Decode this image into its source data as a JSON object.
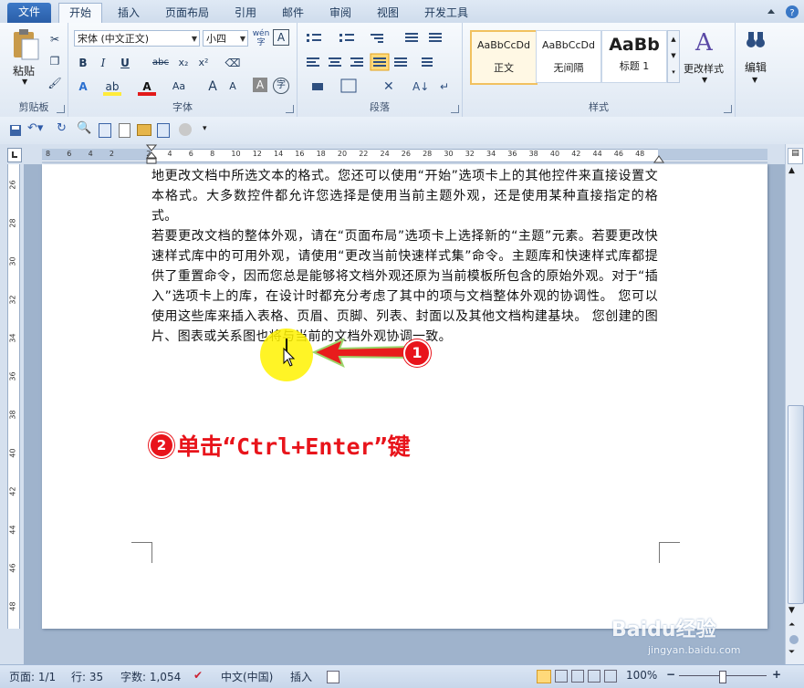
{
  "tabs": [
    "文件",
    "开始",
    "插入",
    "页面布局",
    "引用",
    "邮件",
    "审阅",
    "视图",
    "开发工具"
  ],
  "ribbon": {
    "clipboard": {
      "paste": "粘贴",
      "label": "剪贴板"
    },
    "font": {
      "name": "宋体 (中文正文)",
      "size": "小四",
      "label": "字体",
      "wen": "wén",
      "A": "A",
      "bold": "B",
      "italic": "I",
      "underline": "U",
      "strike": "abc",
      "sub": "x₂",
      "sup": "x²",
      "aa": "Aa",
      "grow": "A",
      "shrink": "A"
    },
    "paragraph": {
      "label": "段落"
    },
    "styles": {
      "label": "样式",
      "tiles": [
        {
          "preview": "AaBbCcDd",
          "name": "正文"
        },
        {
          "preview": "AaBbCcDd",
          "name": "无间隔"
        },
        {
          "preview": "AaBb",
          "name": "标题 1"
        }
      ],
      "change": "更改样式"
    },
    "edit": {
      "label": "编辑"
    }
  },
  "ruler_numbers": [
    "8",
    "6",
    "4",
    "2",
    "2",
    "4",
    "6",
    "8",
    "10",
    "12",
    "14",
    "16",
    "18",
    "20",
    "22",
    "24",
    "26",
    "28",
    "30",
    "32",
    "34",
    "36",
    "38",
    "40",
    "42",
    "44",
    "46",
    "48"
  ],
  "vruler_numbers": [
    "26",
    "28",
    "30",
    "32",
    "34",
    "36",
    "38",
    "40",
    "42",
    "44",
    "46",
    "48"
  ],
  "document": {
    "p1": "地更改文档中所选文本的格式。您还可以使用“开始”选项卡上的其他控件来直接设置文本格式。大多数控件都允许您选择是使用当前主题外观，还是使用某种直接指定的格式。",
    "p2": "若要更改文档的整体外观，请在“页面布局”选项卡上选择新的“主题”元素。若要更改快速样式库中的可用外观，请使用“更改当前快速样式集”命令。主题库和快速样式库都提供了重置命令，因而您总是能够将文档外观还原为当前模板所包含的原始外观。对于“插入”选项卡上的库，在设计时都充分考虑了其中的项与文档整体外观的协调性。 您可以使用这些库来插入表格、页眉、页脚、列表、封面以及其他文档构建基块。 您创建的图片、图表或关系图也将与当前的文档外观协调一致。"
  },
  "annotation": {
    "step1": "1",
    "step2": "2",
    "instruction": "单击“Ctrl+Enter”键",
    "accent": "#e8141b"
  },
  "status": {
    "page": "页面: 1/1",
    "line": "行: 35",
    "words": "字数: 1,054",
    "lang": "中文(中国)",
    "mode": "插入",
    "zoom": "100%"
  },
  "watermark": {
    "brand": "Baidu经验",
    "url": "jingyan.baidu.com"
  }
}
